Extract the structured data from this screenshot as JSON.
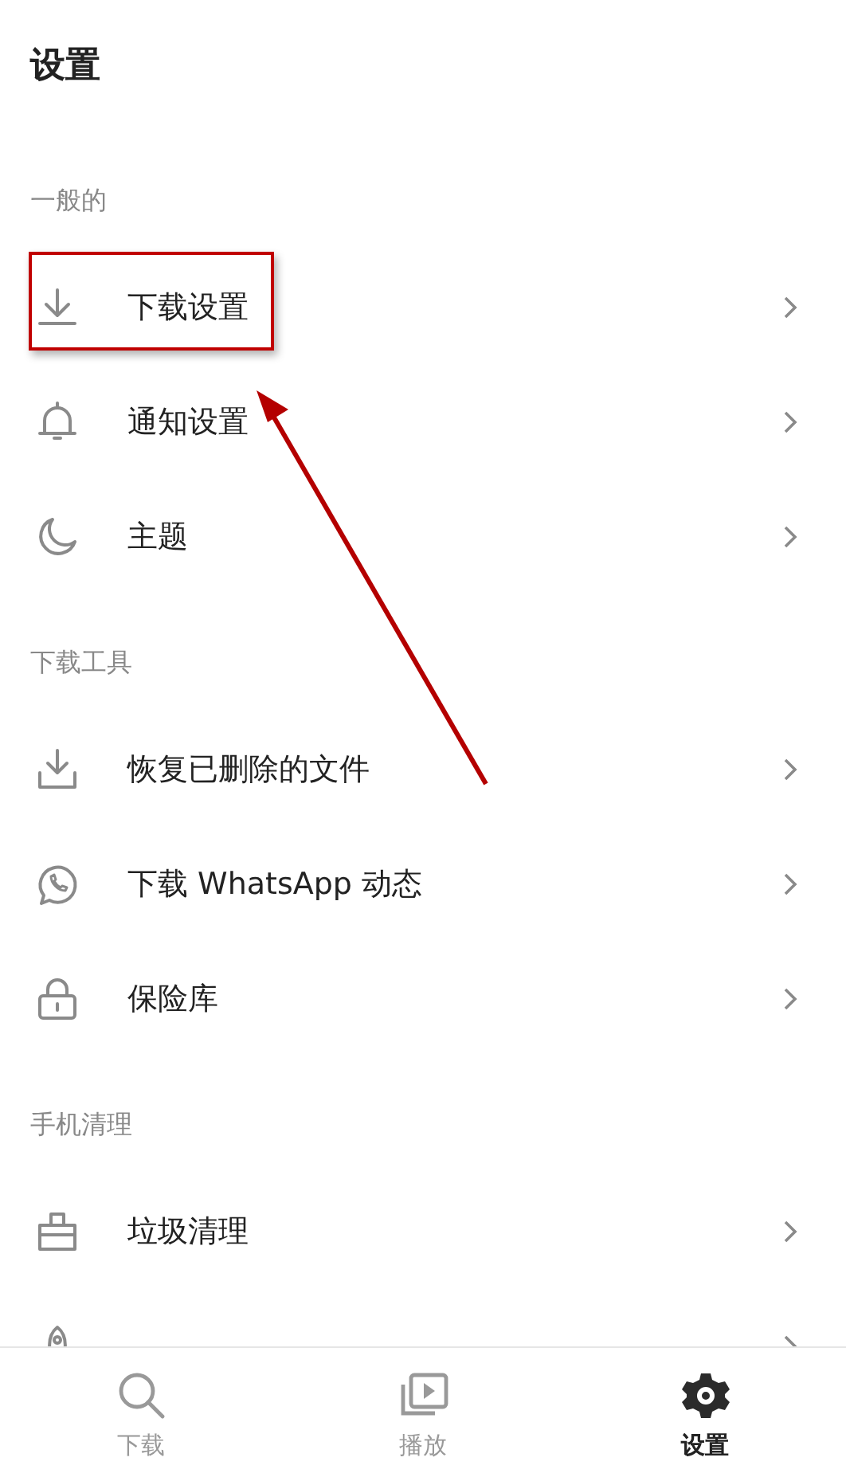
{
  "title": "设置",
  "sections": [
    {
      "label": "一般的",
      "items": [
        {
          "kind": "download",
          "label": "下载设置"
        },
        {
          "kind": "bell",
          "label": "通知设置"
        },
        {
          "kind": "moon",
          "label": "主题"
        }
      ]
    },
    {
      "label": "下载工具",
      "items": [
        {
          "kind": "restore",
          "label": "恢复已删除的文件"
        },
        {
          "kind": "chat",
          "label": "下载 WhatsApp 动态"
        },
        {
          "kind": "lock",
          "label": "保险库"
        }
      ]
    },
    {
      "label": "手机清理",
      "items": [
        {
          "kind": "bin",
          "label": "垃圾清理"
        },
        {
          "kind": "rocket"
        }
      ]
    }
  ],
  "nav": [
    {
      "kind": "search",
      "label": "下载",
      "selected": false
    },
    {
      "kind": "play",
      "label": "播放",
      "selected": false
    },
    {
      "kind": "gear",
      "label": "设置",
      "selected": true
    }
  ]
}
